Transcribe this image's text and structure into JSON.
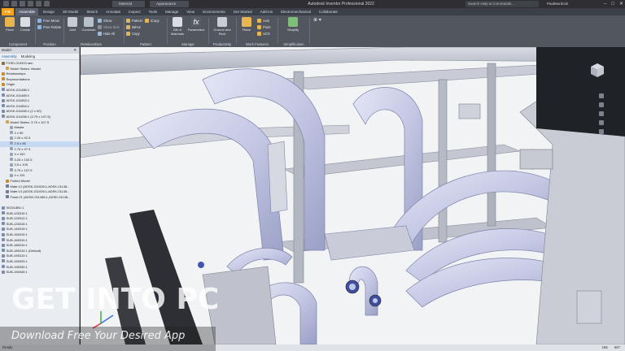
{
  "window": {
    "title": "Autodesk Inventor Professional 2022",
    "material_label": "Material",
    "appearance_label": "Appearance",
    "search_placeholder": "Search Help & Commands...",
    "user": "PaulMurdock",
    "win_controls": [
      "–",
      "□",
      "✕"
    ]
  },
  "tabs": [
    {
      "label": "File"
    },
    {
      "label": "Assemble"
    },
    {
      "label": "Design"
    },
    {
      "label": "3D Model"
    },
    {
      "label": "Sketch"
    },
    {
      "label": "Annotate"
    },
    {
      "label": "Inspect"
    },
    {
      "label": "Tools"
    },
    {
      "label": "Manage"
    },
    {
      "label": "View"
    },
    {
      "label": "Environments"
    },
    {
      "label": "Get Started"
    },
    {
      "label": "Add-Ins"
    },
    {
      "label": "Electromechanical"
    },
    {
      "label": "Collaborate"
    }
  ],
  "ribbon": {
    "component": {
      "label": "Component",
      "place": "Place",
      "create": "Create"
    },
    "position": {
      "label": "Position",
      "free_move": "Free Move",
      "free_rotate": "Free Rotate"
    },
    "relationships": {
      "label": "Relationships",
      "joint": "Joint",
      "constrain": "Constrain",
      "show": "Show",
      "show_sick": "Show Sick",
      "hide_all": "Hide All"
    },
    "pattern": {
      "label": "Pattern",
      "pattern": "Pattern",
      "mirror": "Mirror",
      "copy": "Copy",
      "icopy": "iCopy"
    },
    "manage": {
      "label": "Manage",
      "bom": "Bill of Materials",
      "parameters": "Parameters"
    },
    "productivity": {
      "label": "Productivity",
      "ground_root": "Ground and Root"
    },
    "work_features": {
      "label": "Work Features",
      "plane": "Plane",
      "axis": "Axis",
      "point": "Point",
      "ucs": "UCS"
    },
    "simplification": {
      "label": "Simplification",
      "simplify": "Simplify"
    }
  },
  "panel": {
    "title": "Model",
    "tab_assembly": "Assembly",
    "tab_modeling": "Modeling",
    "tree": [
      {
        "label": "FXSD-019310.iam",
        "indent": 1,
        "icon": "#8a6f3a"
      },
      {
        "label": "Model States: Master",
        "indent": 2,
        "icon": "#d2a24a"
      },
      {
        "label": "Relationships",
        "indent": 1,
        "icon": "#c78b2a"
      },
      {
        "label": "Representations",
        "indent": 1,
        "icon": "#c78b2a"
      },
      {
        "label": "Origin",
        "indent": 1,
        "icon": "#c78b2a"
      },
      {
        "label": "ADSK-011486:1",
        "indent": 1,
        "icon": "#7c8db0"
      },
      {
        "label": "ADSK-011489:1",
        "indent": 1,
        "icon": "#7c8db0"
      },
      {
        "label": "ADSK-011853:1",
        "indent": 1,
        "icon": "#7c8db0"
      },
      {
        "label": "ADSK-011854:1",
        "indent": 1,
        "icon": "#7c8db0"
      },
      {
        "label": "ADSK-011056:1 (2 x 90)",
        "indent": 1,
        "icon": "#7c8db0"
      },
      {
        "label": "ADSK-011056:1 (3.75 x 107.5)",
        "indent": 1,
        "icon": "#7c8db0"
      },
      {
        "label": "Model States: 3.75 x 107.5",
        "indent": 2,
        "icon": "#d2a24a"
      },
      {
        "label": "Master",
        "indent": 3,
        "icon": "#9aa3b3"
      },
      {
        "label": "2 x 90",
        "indent": 3,
        "icon": "#9aa3b3"
      },
      {
        "label": "2.25 x 92.5",
        "indent": 3,
        "icon": "#9aa3b3"
      },
      {
        "label": "2.5 x 95",
        "indent": 3,
        "icon": "#9aa3b3",
        "selected": true
      },
      {
        "label": "2.75 x 97.5",
        "indent": 3,
        "icon": "#9aa3b3"
      },
      {
        "label": "3 x 100",
        "indent": 3,
        "icon": "#9aa3b3"
      },
      {
        "label": "3.25 x 102.5",
        "indent": 3,
        "icon": "#9aa3b3"
      },
      {
        "label": "3.5 x 105",
        "indent": 3,
        "icon": "#9aa3b3"
      },
      {
        "label": "3.75 x 107.5",
        "indent": 3,
        "icon": "#9aa3b3"
      },
      {
        "label": "4 x 110",
        "indent": 3,
        "icon": "#9aa3b3"
      },
      {
        "label": "Folded Model",
        "indent": 2,
        "icon": "#c78b2a"
      },
      {
        "label": "Mate:12 (ADSK-011006:1,ADSK-01148...",
        "indent": 2,
        "icon": "#6f7b8e"
      },
      {
        "label": "Mate:13 (ADSK-011006:1,ADSK-01148...",
        "indent": 2,
        "icon": "#6f7b8e"
      },
      {
        "label": "Flush:21 (ADSK-011486:1,ADSK-01148...",
        "indent": 2,
        "icon": "#6f7b8e"
      },
      {
        "label": "",
        "indent": 1,
        "icon": ""
      },
      {
        "label": "SIG518B1:1",
        "indent": 1,
        "icon": "#7c8db0"
      },
      {
        "label": "SUB-128310:1",
        "indent": 1,
        "icon": "#7c8db0"
      },
      {
        "label": "SUB-128312:1",
        "indent": 1,
        "icon": "#7c8db0"
      },
      {
        "label": "SUB-128315:1",
        "indent": 1,
        "icon": "#7c8db0"
      },
      {
        "label": "SUB-148310:1",
        "indent": 1,
        "icon": "#7c8db0"
      },
      {
        "label": "SUB-158310:1",
        "indent": 1,
        "icon": "#7c8db0"
      },
      {
        "label": "SUB-168310:1",
        "indent": 1,
        "icon": "#7c8db0"
      },
      {
        "label": "SUB-188310:1",
        "indent": 1,
        "icon": "#7c8db0"
      },
      {
        "label": "SUB-188310:1 (Default)",
        "indent": 1,
        "icon": "#7c8db0"
      },
      {
        "label": "SUB-198310:1",
        "indent": 1,
        "icon": "#7c8db0"
      },
      {
        "label": "SUB-198320:1",
        "indent": 1,
        "icon": "#7c8db0"
      },
      {
        "label": "SUB-198330:1",
        "indent": 1,
        "icon": "#7c8db0"
      },
      {
        "label": "SUB-198340:1",
        "indent": 1,
        "icon": "#7c8db0"
      }
    ]
  },
  "status": {
    "left": "Ready",
    "right_1": "165",
    "right_2": "567"
  },
  "watermark": {
    "title": "GET INTO PC",
    "subtitle": "Download Free Your Desired App"
  }
}
